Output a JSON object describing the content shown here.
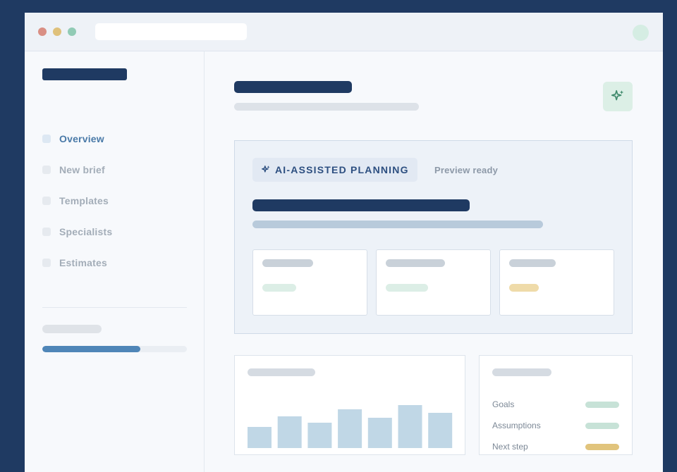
{
  "sidebar": {
    "items": [
      {
        "label": "Overview",
        "active": true
      },
      {
        "label": "New brief",
        "active": false
      },
      {
        "label": "Templates",
        "active": false
      },
      {
        "label": "Specialists",
        "active": false
      },
      {
        "label": "Estimates",
        "active": false
      }
    ],
    "progress": 0.68
  },
  "header": {
    "action_icon": "sparkle-icon"
  },
  "ai_panel": {
    "badge_label": "AI-ASSISTED PLANNING",
    "badge_icon": "sparkle-icon",
    "status": "Preview ready",
    "cards": [
      {
        "accent": "#dceee6"
      },
      {
        "accent": "#dceee6"
      },
      {
        "accent": "#efdba9"
      }
    ]
  },
  "chart_data": {
    "type": "bar",
    "categories": [
      "",
      "",
      "",
      "",
      "",
      "",
      ""
    ],
    "values": [
      30,
      45,
      36,
      55,
      43,
      61,
      50
    ],
    "ylim": [
      0,
      100
    ],
    "color": "#c0d7e6"
  },
  "legend": {
    "rows": [
      {
        "label": "Goals",
        "color": "#c7e2d7"
      },
      {
        "label": "Assumptions",
        "color": "#c7e2d7"
      },
      {
        "label": "Next step",
        "color": "#e1c47c"
      }
    ]
  },
  "colors": {
    "brand": "#1f3a62",
    "accent": "#4f86b8"
  }
}
